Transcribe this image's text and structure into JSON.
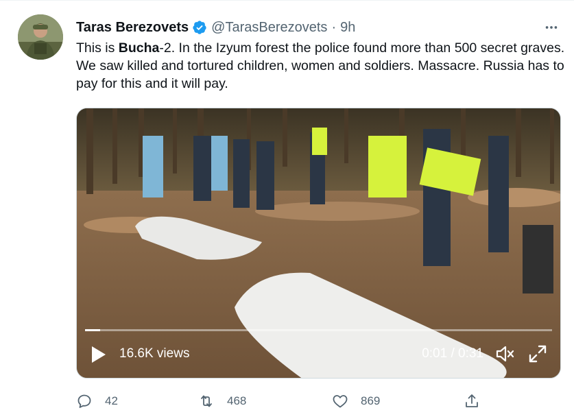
{
  "tweet": {
    "author_name": "Taras Berezovets",
    "handle": "@TarasBerezovets",
    "separator": "·",
    "time": "9h",
    "text_prefix": "This is ",
    "text_bold": "Bucha",
    "text_rest": "-2. In the Izyum forest the police found more than 500 secret graves. We saw killed and tortured children, women and soldiers. Massacre. Russia has to pay for this and it will pay.",
    "verified": true
  },
  "video": {
    "views": "16.6K views",
    "time_readout": "0:01 / 0:31",
    "progress_fraction": 0.032
  },
  "actions": {
    "replies": "42",
    "retweets": "468",
    "likes": "869"
  },
  "icons": {
    "more": "more-icon",
    "reply": "reply-icon",
    "retweet": "retweet-icon",
    "like": "heart-icon",
    "share": "share-icon",
    "play": "play-icon",
    "volume": "volume-icon",
    "fullscreen": "fullscreen-icon",
    "verified": "verified-badge-icon"
  },
  "colors": {
    "accent": "#1d9bf0",
    "muted": "#536471",
    "text": "#0f1419"
  }
}
